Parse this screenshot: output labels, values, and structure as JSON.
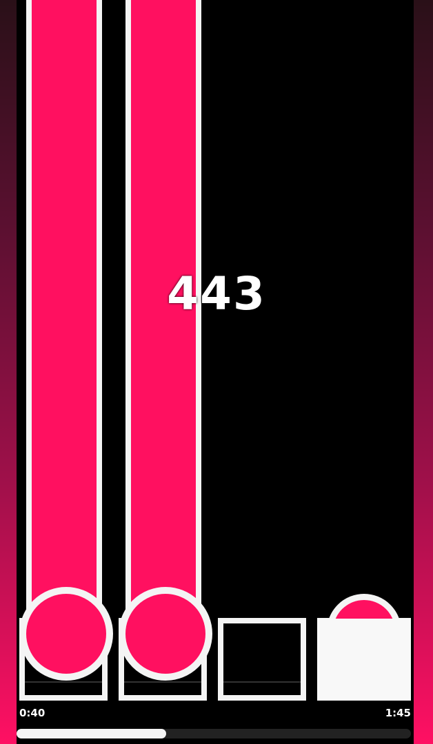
{
  "game": {
    "combo": "443",
    "time_elapsed": "0:40",
    "time_total": "1:45",
    "progress_fraction": 0.38,
    "colors": {
      "note": "#ff1060",
      "outline": "#f4f4f4",
      "background": "#000000",
      "side_gradient_bottom": "#ff1063"
    },
    "lanes": [
      {
        "name": "lane-1",
        "hold_note": true,
        "receptor_pressed": false
      },
      {
        "name": "lane-2",
        "hold_note": true,
        "receptor_pressed": false
      },
      {
        "name": "lane-3",
        "hold_note": false,
        "receptor_pressed": false
      },
      {
        "name": "lane-4",
        "hold_note": false,
        "receptor_pressed": true
      }
    ]
  }
}
